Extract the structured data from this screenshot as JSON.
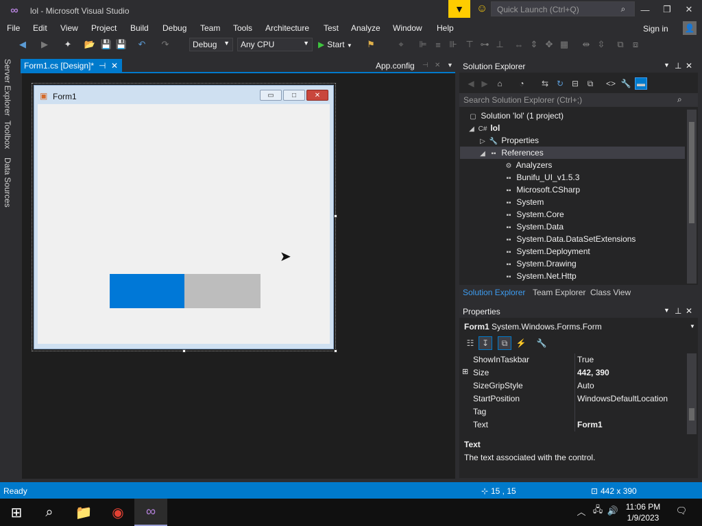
{
  "window": {
    "title": "lol - Microsoft Visual Studio",
    "quick_launch_placeholder": "Quick Launch (Ctrl+Q)"
  },
  "menu": {
    "items": [
      "File",
      "Edit",
      "View",
      "Project",
      "Build",
      "Debug",
      "Team",
      "Tools",
      "Architecture",
      "Test",
      "Analyze",
      "Window",
      "Help"
    ],
    "sign_in": "Sign in"
  },
  "toolbar": {
    "config": "Debug",
    "platform": "Any CPU",
    "start": "Start"
  },
  "left_rail": [
    "Server Explorer",
    "Toolbox",
    "Data Sources"
  ],
  "tabs": {
    "active": "Form1.cs [Design]*",
    "other": "App.config"
  },
  "form": {
    "title": "Form1",
    "progress_value": 0.5,
    "progress_fill": "#0078d7",
    "progress_track": "#bdbdbd"
  },
  "solution_explorer": {
    "title": "Solution Explorer",
    "search_placeholder": "Search Solution Explorer (Ctrl+;)",
    "solution": "Solution 'lol' (1 project)",
    "project": "lol",
    "properties": "Properties",
    "references": "References",
    "refs": [
      "Analyzers",
      "Bunifu_UI_v1.5.3",
      "Microsoft.CSharp",
      "System",
      "System.Core",
      "System.Data",
      "System.Data.DataSetExtensions",
      "System.Deployment",
      "System.Drawing",
      "System.Net.Http"
    ],
    "tabs": [
      "Solution Explorer",
      "Team Explorer",
      "Class View"
    ]
  },
  "properties": {
    "title": "Properties",
    "object_name": "Form1",
    "object_type": "System.Windows.Forms.Form",
    "rows": [
      {
        "name": "ShowInTaskbar",
        "value": "True",
        "bold": false
      },
      {
        "name": "Size",
        "value": "442, 390",
        "bold": true
      },
      {
        "name": "SizeGripStyle",
        "value": "Auto",
        "bold": false
      },
      {
        "name": "StartPosition",
        "value": "WindowsDefaultLocation",
        "bold": false
      },
      {
        "name": "Tag",
        "value": "",
        "bold": false
      },
      {
        "name": "Text",
        "value": "Form1",
        "bold": true
      }
    ],
    "desc_title": "Text",
    "desc_text": "The text associated with the control."
  },
  "status": {
    "state": "Ready",
    "position": "15 , 15",
    "size": "442 x 390"
  },
  "clock": {
    "time": "11:06 PM",
    "date": "1/9/2023"
  },
  "colors": {
    "accent": "#007acc",
    "background": "#2d2d30"
  }
}
